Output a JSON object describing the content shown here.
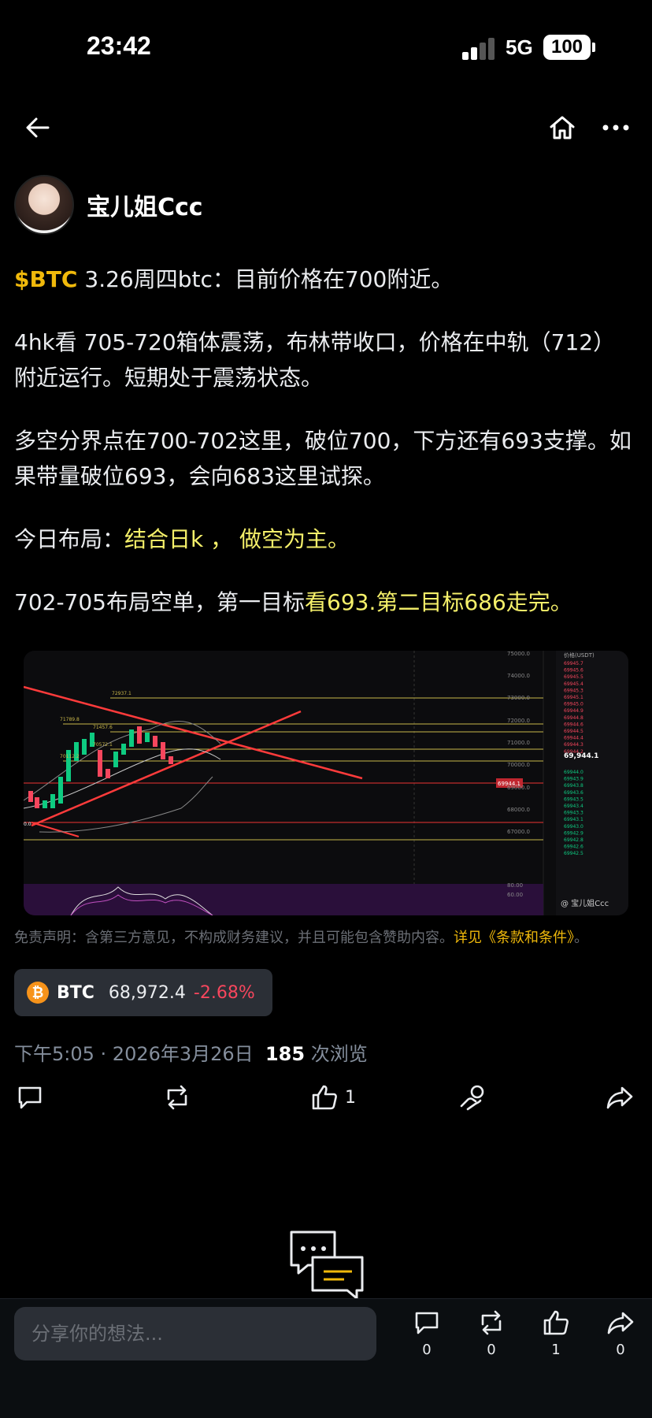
{
  "status_bar": {
    "time": "23:42",
    "network": "5G",
    "battery": "100"
  },
  "author": {
    "name": "宝儿姐Ccc"
  },
  "post": {
    "cashtag": "$BTC",
    "p1_rest": " 3.26周四btc：目前价格在700附近。",
    "p2": "4hk看 705-720箱体震荡，布林带收口，价格在中轨（712）附近运行。短期处于震荡状态。",
    "p3": "多空分界点在700-702这里，破位700，下方还有693支撑。如果带量破位693，会向683这里试探。",
    "p4_prefix": "今日布局：",
    "p4_highlight": "结合日k ，  做空为主。",
    "p5_prefix": "702-705布局空单，第一目标",
    "p5_highlight": "看693.第二目标686走完。"
  },
  "chart_image": {
    "price_axis_title": "价格(USDT)",
    "current_price": "69,944.1",
    "current_tag": "69944.1",
    "y_ticks": [
      "75000.0",
      "74000.0",
      "73000.0",
      "72000.0",
      "71000.0",
      "70000.0",
      "69000.0",
      "68000.0",
      "67000.0"
    ],
    "level_labels": [
      "72937.1",
      "71789.8",
      "71457.6",
      "70572.1",
      "70112.2",
      "0.0"
    ],
    "rsi_ticks": [
      "80.00",
      "60.00"
    ],
    "watermark": "@ 宝儿姐Ccc",
    "orderbook_asks": [
      "69945.7",
      "69945.6",
      "69945.5",
      "69945.4",
      "69945.3",
      "69945.1",
      "69945.0",
      "69944.9",
      "69944.8",
      "69944.6",
      "69944.5",
      "69944.4",
      "69944.3",
      "69944.2"
    ],
    "orderbook_bids": [
      "69944.0",
      "69943.9",
      "69943.8",
      "69943.6",
      "69943.5",
      "69943.4",
      "69943.3",
      "69943.1",
      "69943.0",
      "69942.9",
      "69942.8",
      "69942.6",
      "69942.5"
    ]
  },
  "disclaimer": {
    "text": "免责声明：含第三方意见，不构成财务建议，并且可能包含赞助内容。",
    "link": "详见《条款和条件》",
    "end": "。"
  },
  "coin": {
    "icon": "₿",
    "symbol": "BTC",
    "price": "68,972.4",
    "change": "-2.68%"
  },
  "meta": {
    "time": "下午5:05",
    "separator": " · ",
    "date": "2026年3月26日",
    "views_count": "185",
    "views_label": " 次浏览"
  },
  "actions": {
    "like_count": "1"
  },
  "bottom_bar": {
    "placeholder": "分享你的想法...",
    "comment_count": "0",
    "repost_count": "0",
    "like_count": "1",
    "share_count": "0"
  },
  "colors": {
    "accent": "#f0b90b",
    "down": "#f6465d",
    "up": "#0ecb81",
    "highlight": "#f5f06a"
  }
}
